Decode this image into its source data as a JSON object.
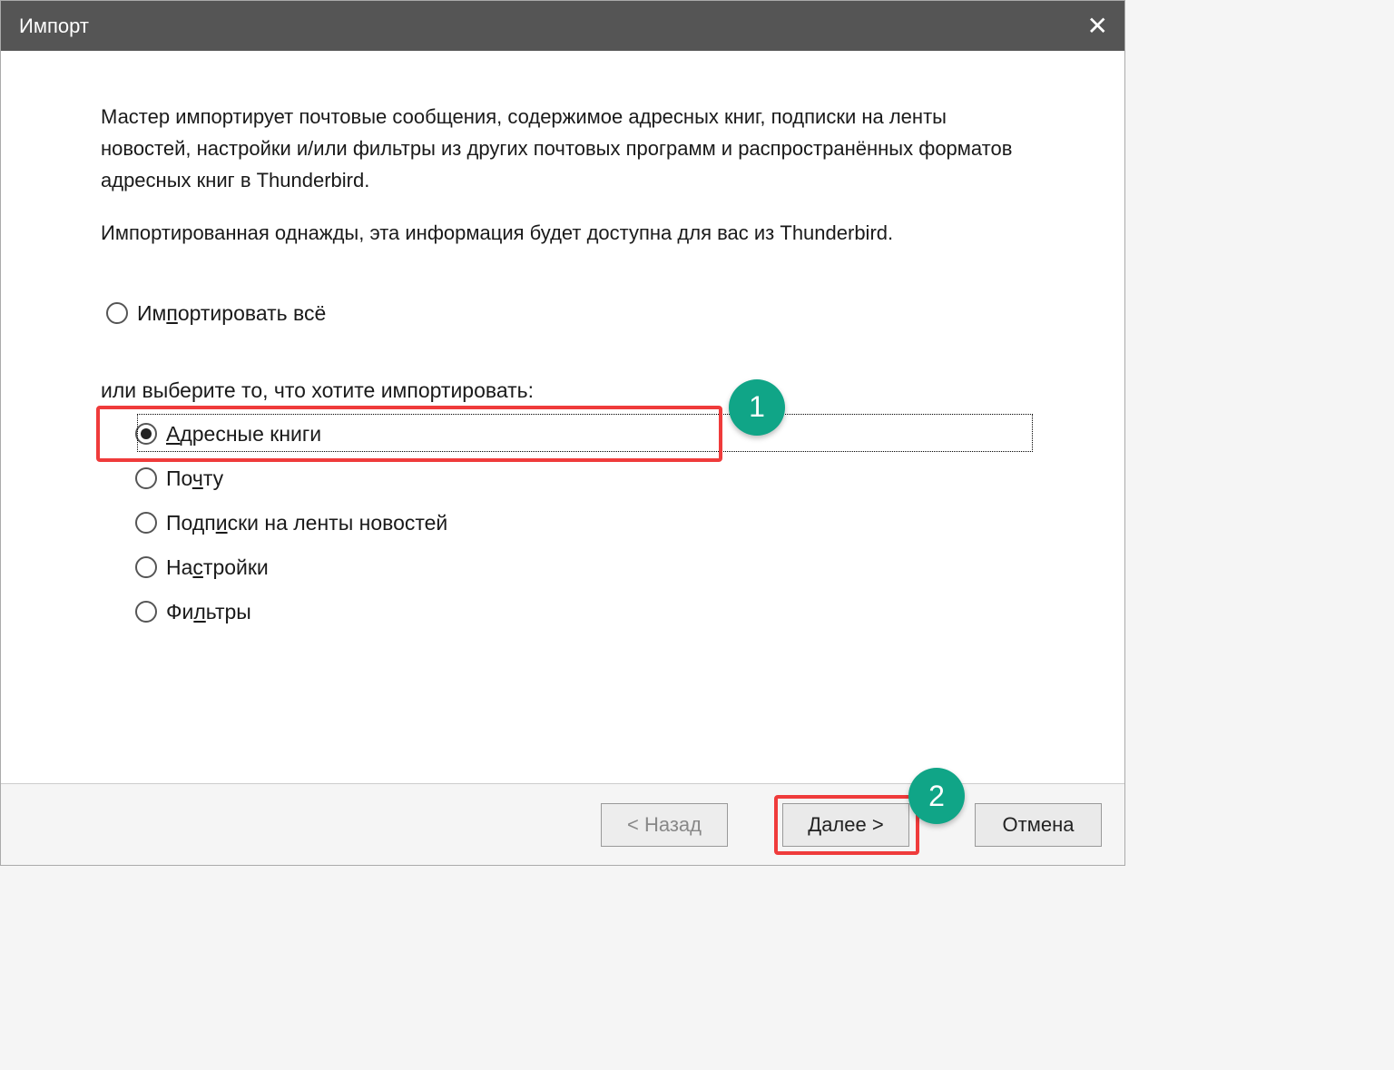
{
  "title": "Импорт",
  "desc1": "Мастер импортирует почтовые сообщения, содержимое адресных книг, подписки на ленты новостей, настройки и/или фильтры из других почтовых программ и распространённых форматов адресных книг в Thunderbird.",
  "desc2": "Импортированная однажды, эта информация будет доступна для вас из Thunderbird.",
  "radio_all_pre": "Им",
  "radio_all_u": "п",
  "radio_all_post": "ортировать всё",
  "prompt2": "или выберите то, что хотите импортировать:",
  "options": {
    "addressbooks": {
      "pre": "",
      "u": "А",
      "post": "дресные книги",
      "checked": true
    },
    "mail": {
      "pre": "По",
      "u": "ч",
      "post": "ту",
      "checked": false
    },
    "feeds": {
      "pre": "Подп",
      "u": "и",
      "post": "ски на ленты новостей",
      "checked": false
    },
    "settings": {
      "pre": "На",
      "u": "с",
      "post": "тройки",
      "checked": false
    },
    "filters": {
      "pre": "Фи",
      "u": "л",
      "post": "ьтры",
      "checked": false
    }
  },
  "buttons": {
    "back": "< Назад",
    "next": "Далее >",
    "cancel": "Отмена"
  },
  "annotations": {
    "badge1": "1",
    "badge2": "2"
  }
}
